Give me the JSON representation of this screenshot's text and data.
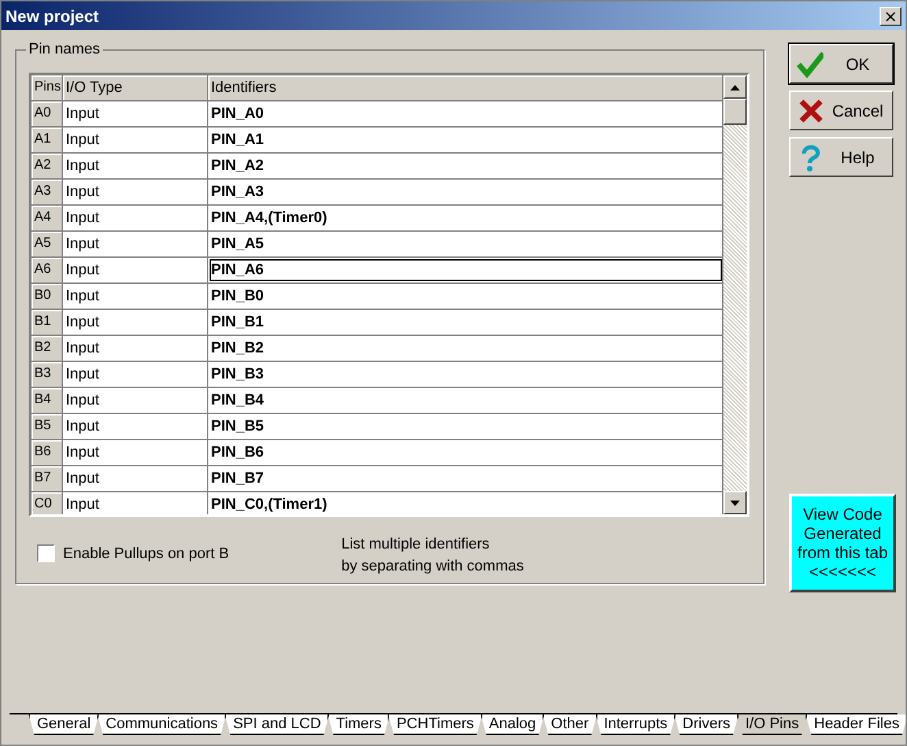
{
  "window": {
    "title": "New project",
    "close": "×"
  },
  "group": {
    "title": "Pin names"
  },
  "table": {
    "columns": [
      "Pins",
      "I/O Type",
      "Identifiers"
    ],
    "rows": [
      {
        "pin": "A0",
        "type": "Input",
        "identifier": "PIN_A0",
        "selected": false
      },
      {
        "pin": "A1",
        "type": "Input",
        "identifier": "PIN_A1",
        "selected": false
      },
      {
        "pin": "A2",
        "type": "Input",
        "identifier": "PIN_A2",
        "selected": false
      },
      {
        "pin": "A3",
        "type": "Input",
        "identifier": "PIN_A3",
        "selected": false
      },
      {
        "pin": "A4",
        "type": "Input",
        "identifier": "PIN_A4,(Timer0)",
        "selected": false
      },
      {
        "pin": "A5",
        "type": "Input",
        "identifier": "PIN_A5",
        "selected": false
      },
      {
        "pin": "A6",
        "type": "Input",
        "identifier": "PIN_A6",
        "selected": true
      },
      {
        "pin": "B0",
        "type": "Input",
        "identifier": "PIN_B0",
        "selected": false
      },
      {
        "pin": "B1",
        "type": "Input",
        "identifier": "PIN_B1",
        "selected": false
      },
      {
        "pin": "B2",
        "type": "Input",
        "identifier": "PIN_B2",
        "selected": false
      },
      {
        "pin": "B3",
        "type": "Input",
        "identifier": "PIN_B3",
        "selected": false
      },
      {
        "pin": "B4",
        "type": "Input",
        "identifier": "PIN_B4",
        "selected": false
      },
      {
        "pin": "B5",
        "type": "Input",
        "identifier": "PIN_B5",
        "selected": false
      },
      {
        "pin": "B6",
        "type": "Input",
        "identifier": "PIN_B6",
        "selected": false
      },
      {
        "pin": "B7",
        "type": "Input",
        "identifier": "PIN_B7",
        "selected": false
      },
      {
        "pin": "C0",
        "type": "Input",
        "identifier": "PIN_C0,(Timer1)",
        "selected": false
      }
    ]
  },
  "pullups": {
    "label": "Enable Pullups on port B",
    "checked": false
  },
  "hint": [
    "List multiple identifiers",
    "by separating with commas"
  ],
  "buttons": [
    {
      "label": "OK",
      "kind": "ok",
      "default": true
    },
    {
      "label": "Cancel",
      "kind": "cancel",
      "default": false
    },
    {
      "label": "Help",
      "kind": "help",
      "default": false
    }
  ],
  "view_code": [
    "View Code",
    "Generated",
    "from this tab",
    "<<<<<<<"
  ],
  "tabs": [
    {
      "label": "General",
      "selected": false
    },
    {
      "label": "Communications",
      "selected": false
    },
    {
      "label": "SPI and LCD",
      "selected": false
    },
    {
      "label": "Timers",
      "selected": false
    },
    {
      "label": "PCHTimers",
      "selected": false
    },
    {
      "label": "Analog",
      "selected": false
    },
    {
      "label": "Other",
      "selected": false
    },
    {
      "label": "Interrupts",
      "selected": false
    },
    {
      "label": "Drivers",
      "selected": false
    },
    {
      "label": "I/O Pins",
      "selected": true
    },
    {
      "label": "Header Files",
      "selected": false
    }
  ]
}
